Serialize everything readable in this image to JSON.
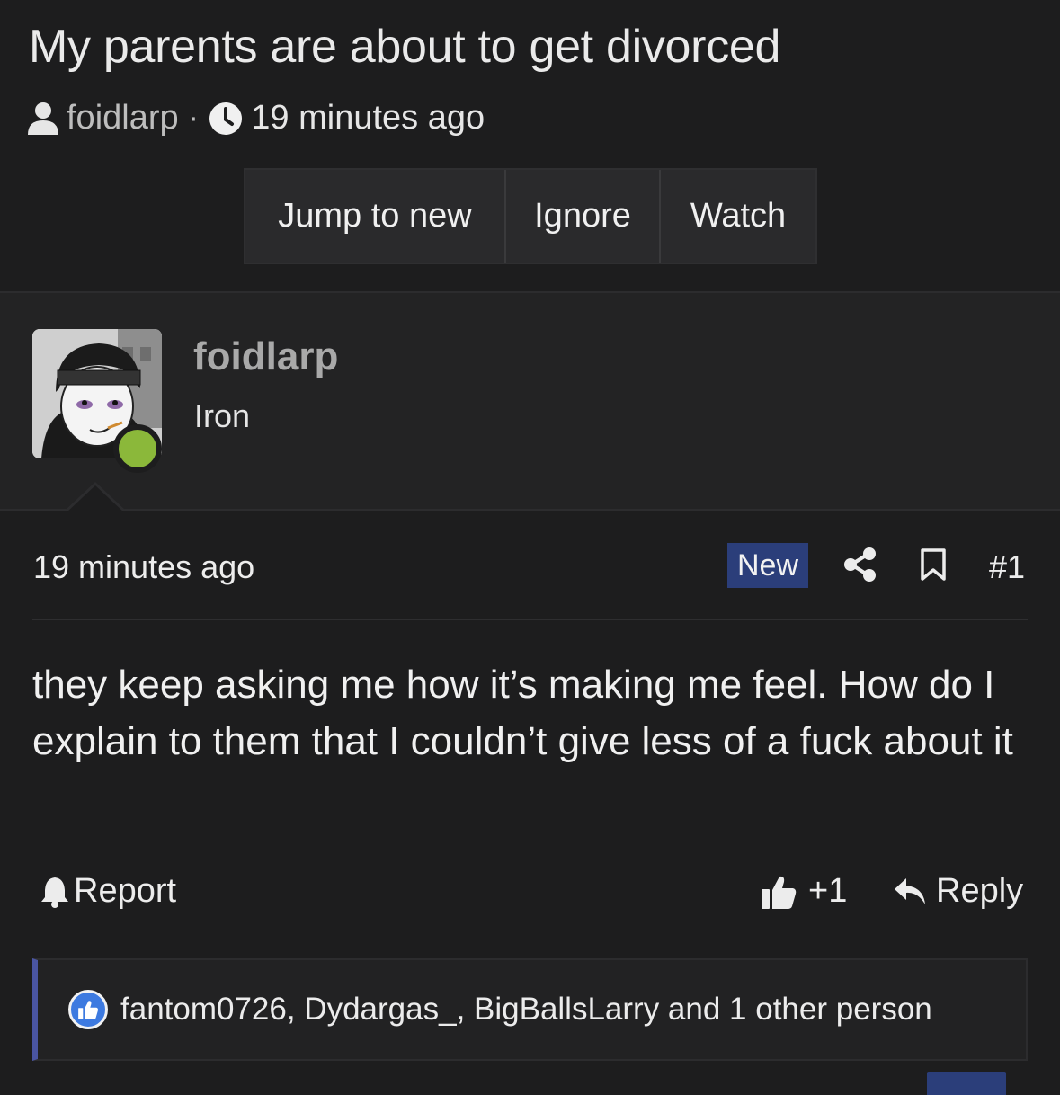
{
  "thread": {
    "title": "My parents are about to get divorced",
    "author": "foidlarp",
    "separator": "·",
    "time": "19 minutes ago"
  },
  "actions": {
    "jump_label": "Jump to new",
    "ignore_label": "Ignore",
    "watch_label": "Watch"
  },
  "post": {
    "username": "foidlarp",
    "user_title": "Iron",
    "time": "19 minutes ago",
    "badge": "New",
    "number": "#1",
    "body": "they keep asking me how it’s making me feel. How do I explain to them that I couldn’t give less of a fuck about it",
    "report_label": "Report",
    "like_label": "+1",
    "reply_label": "Reply",
    "reactions_text": "fantom0726, Dydargas_, BigBallsLarry and 1 other person"
  },
  "icons": {
    "user": "user-icon",
    "clock": "clock-icon",
    "share": "share-icon",
    "bookmark": "bookmark-icon",
    "bell": "bell-icon",
    "thumbs_up": "thumbs-up-icon",
    "reply": "reply-icon"
  },
  "colors": {
    "background": "#1d1d1e",
    "new_badge": "#2b3e7a",
    "online": "#8bb83a",
    "reaction_border": "#4a55a2",
    "like_blue": "#3d7ae0"
  }
}
